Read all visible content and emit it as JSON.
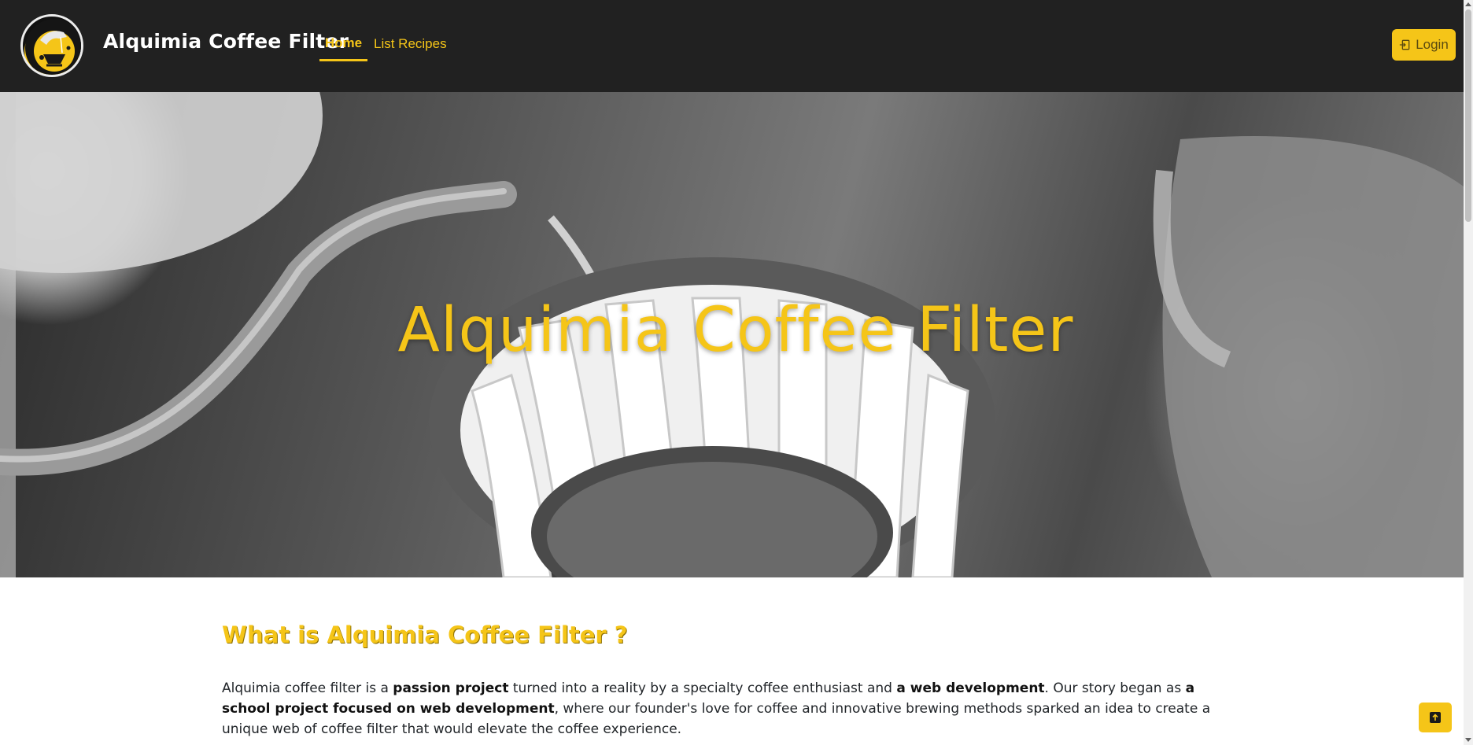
{
  "navbar": {
    "brand": "Alquimia Coffee Filter",
    "links": [
      {
        "label": "Home",
        "active": true
      },
      {
        "label": "List Recipes",
        "active": false
      }
    ],
    "login_label": "Login",
    "logo_icon": "coffee-pour-logo"
  },
  "hero": {
    "title": "Alquimia Coffee Filter"
  },
  "about": {
    "heading": "What is Alquimia Coffee Filter ?",
    "paragraph_parts": [
      {
        "text": "Alquimia coffee filter is a ",
        "bold": false
      },
      {
        "text": "passion project",
        "bold": true
      },
      {
        "text": " turned into a reality by a specialty coffee enthusiast and ",
        "bold": false
      },
      {
        "text": "a web development",
        "bold": true
      },
      {
        "text": ". Our story began as ",
        "bold": false
      },
      {
        "text": "a school project focused on web development",
        "bold": true
      },
      {
        "text": ", where our founder's love for coffee and innovative brewing methods sparked an idea to create a unique web of coffee filter that would elevate the coffee experience.",
        "bold": false
      }
    ]
  },
  "controls": {
    "scroll_top_icon": "arrow-up-icon"
  },
  "colors": {
    "accent": "#f5c518",
    "navbar_bg": "#212121"
  }
}
